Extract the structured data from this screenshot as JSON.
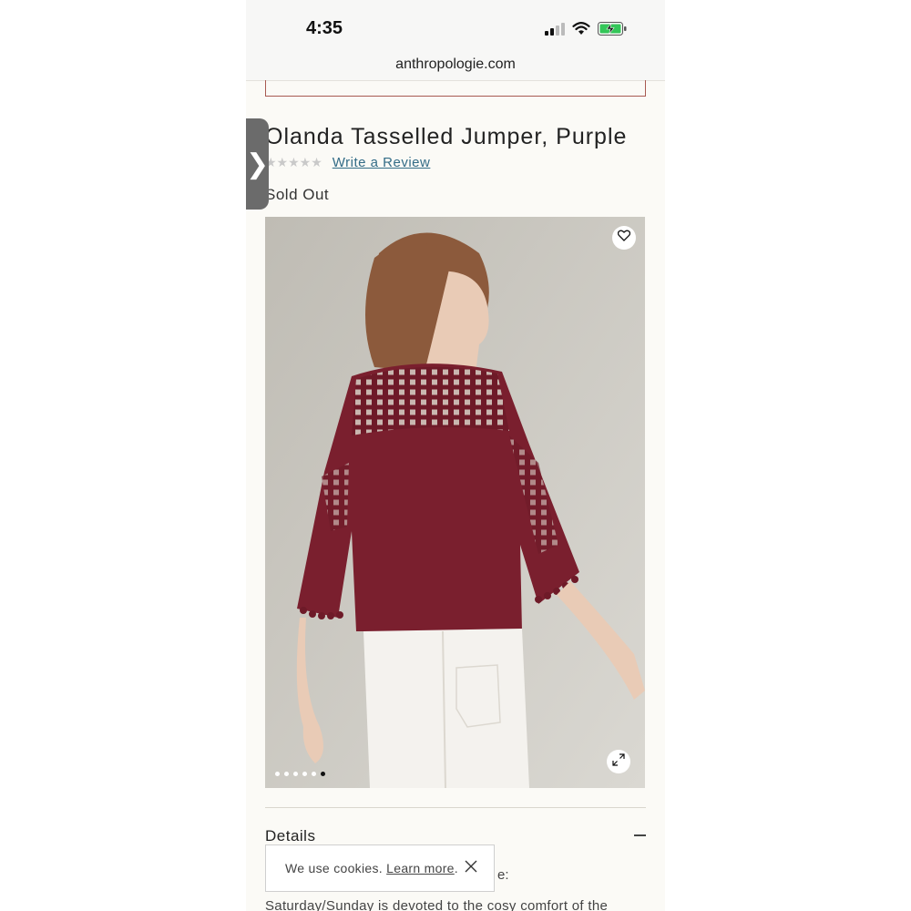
{
  "status_bar": {
    "time": "4:35",
    "icons": [
      "cellular-signal-icon",
      "wifi-icon",
      "battery-charging-icon"
    ]
  },
  "browser": {
    "url": "anthropologie.com"
  },
  "side_tab": {
    "icon": "chevron-right-icon",
    "glyph": "❯"
  },
  "product": {
    "title": "Olanda Tasselled Jumper, Purple",
    "stars": "★★★★★",
    "review_link": "Write a Review",
    "availability": "Sold Out",
    "image_dot_count": 6,
    "active_image_index": 5,
    "colors": {
      "garment": "#7a1f2e",
      "background": "#d0cec8"
    }
  },
  "details": {
    "title": "Details",
    "partial_text": "e:",
    "description": "Saturday/Sunday is devoted to the cosy comfort of the"
  },
  "cookie_banner": {
    "text": "We use cookies. ",
    "link": "Learn more",
    "suffix": "."
  },
  "colors": {
    "link": "#336c87",
    "page_bg": "#fbfaf6",
    "accent_border": "#a85a52"
  }
}
